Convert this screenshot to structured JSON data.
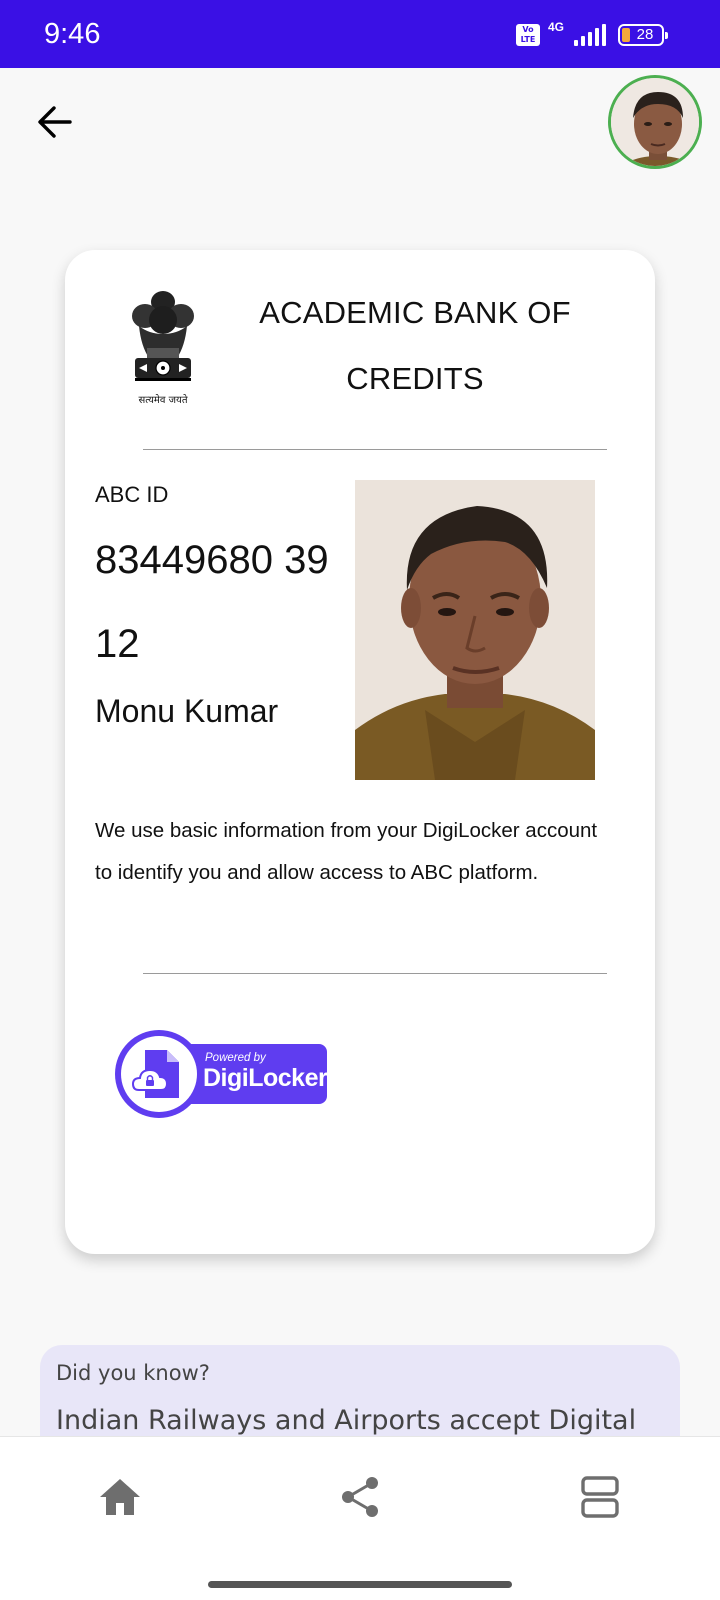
{
  "status_bar": {
    "time": "9:46",
    "volte": "Vo LTE",
    "network": "4G",
    "battery": "28"
  },
  "header": {
    "back_icon": "arrow-left-icon",
    "avatar_icon": "profile-photo"
  },
  "card": {
    "emblem_caption": "सत्यमेव जयते",
    "title": "ACADEMIC BANK OF CREDITS",
    "abc_label": "ABC ID",
    "abc_id": "83449680 3912",
    "name": "Monu Kumar",
    "info": "We use basic information from your DigiLocker account to identify you and allow access to ABC platform.",
    "badge": {
      "powered_by": "Powered by",
      "brand": "DigiLocker"
    }
  },
  "did_you_know": {
    "title": "Did you know?",
    "text": "Indian Railways and Airports accept Digital"
  },
  "bottom_nav": {
    "items": [
      "home-icon",
      "share-icon",
      "documents-icon"
    ]
  },
  "colors": {
    "status_bar": "#3a10e5",
    "brand_purple": "#5f3df0",
    "avatar_ring": "#4caf50",
    "info_card_bg": "#e8e6f8"
  }
}
